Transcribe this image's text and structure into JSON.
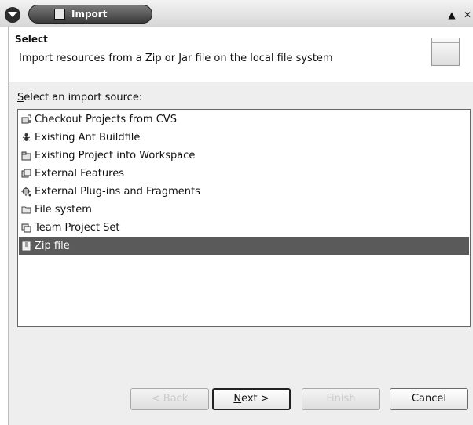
{
  "window": {
    "title": "Import",
    "maximize_glyph": "▲",
    "close_glyph": "✕"
  },
  "header": {
    "title": "Select",
    "description": "Import resources from a Zip or Jar file on the local file system"
  },
  "list": {
    "label_mnemonic": "S",
    "label_rest": "elect an import source:",
    "items": [
      {
        "label": "Checkout Projects from CVS",
        "icon": "cvs-checkout-icon"
      },
      {
        "label": "Existing Ant Buildfile",
        "icon": "ant-icon"
      },
      {
        "label": "Existing Project into Workspace",
        "icon": "project-icon"
      },
      {
        "label": "External Features",
        "icon": "feature-icon"
      },
      {
        "label": "External Plug-ins and Fragments",
        "icon": "plugin-icon"
      },
      {
        "label": "File system",
        "icon": "folder-icon"
      },
      {
        "label": "Team Project Set",
        "icon": "team-project-icon"
      },
      {
        "label": "Zip file",
        "icon": "zip-file-icon",
        "selected": true
      }
    ]
  },
  "buttons": {
    "back": "< Back",
    "next_mnemonic": "N",
    "next_rest": "ext >",
    "finish": "Finish",
    "cancel": "Cancel"
  },
  "colors": {
    "selection": "#5a5a5a",
    "list_background": "#ffffff",
    "dialog_background": "#eeeeee"
  }
}
